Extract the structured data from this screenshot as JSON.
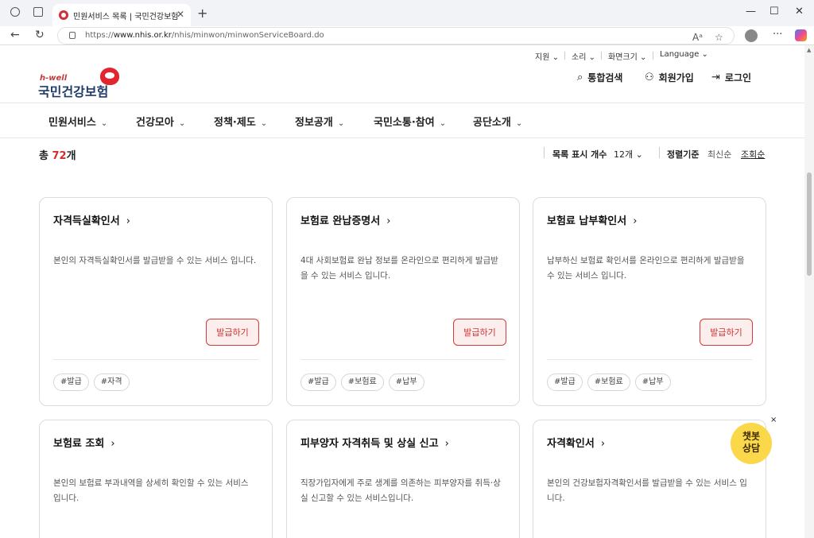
{
  "browser": {
    "tab_title": "민원서비스 목록 | 국민건강보험",
    "tab_close": "✕",
    "new_tab": "+",
    "url_prefix": "https://",
    "url_domain": "www.nhis.or.kr",
    "url_path": "/nhis/minwon/minwonServiceBoard.do",
    "window_controls": [
      "—",
      "☐",
      "✕"
    ],
    "nav": [
      "←",
      "↻"
    ],
    "more": "···"
  },
  "utility": {
    "items": [
      "지원 ⌄",
      "소리 ⌄",
      "화면크기 ⌄",
      "Language ⌄"
    ]
  },
  "logo": {
    "brand": "h-well",
    "name": "국민건강보험"
  },
  "header": {
    "search": "통합검색",
    "join": "회원가입",
    "login": "로그인"
  },
  "gnb": {
    "items": [
      "민원서비스",
      "건강모아",
      "정책·제도",
      "정보공개",
      "국민소통·참여",
      "공단소개"
    ],
    "chev": "⌄"
  },
  "list": {
    "total_prefix": "총 ",
    "total_count": "72",
    "total_suffix": "개",
    "display_label": "목록 표시 개수",
    "display_value": "12개 ⌄",
    "sort_label": "정렬기준",
    "sort_latest": "최신순",
    "sort_views": "조회순"
  },
  "cards": [
    {
      "title": "자격득실확인서",
      "desc": "본인의 자격득실확인서를 발급받을 수 있는 서비스 입니다.",
      "button": "발급하기",
      "tags": [
        "#발급",
        "#자격"
      ]
    },
    {
      "title": "보험료 완납증명서",
      "desc": "4대 사회보험료 완납 정보를 온라인으로 편리하게 발급받을 수 있는 서비스 입니다.",
      "button": "발급하기",
      "tags": [
        "#발급",
        "#보험료",
        "#납부"
      ]
    },
    {
      "title": "보험료 납부확인서",
      "desc": "납부하신 보험료 확인서를 온라인으로 편리하게 발급받을 수 있는 서비스 입니다.",
      "button": "발급하기",
      "tags": [
        "#발급",
        "#보험료",
        "#납부"
      ]
    },
    {
      "title": "보험료 조회",
      "desc": "본인의 보험료 부과내역을 상세히 확인할 수 있는 서비스 입니다."
    },
    {
      "title": "피부양자 자격취득 및 상실 신고",
      "desc": "직장가입자에게 주로 생계를 의존하는 피부양자를 취득·상실 신고할 수 있는 서비스입니다."
    },
    {
      "title": "자격확인서",
      "desc": "본인의 건강보험자격확인서를 발급받을 수 있는 서비스 입니다."
    }
  ],
  "chatbot": {
    "line1": "챗봇",
    "line2": "상담",
    "close": "×"
  },
  "colors": {
    "accent": "#d62b2b",
    "chatbot": "#fbd74a",
    "logo_navy": "#1f3b6b"
  }
}
